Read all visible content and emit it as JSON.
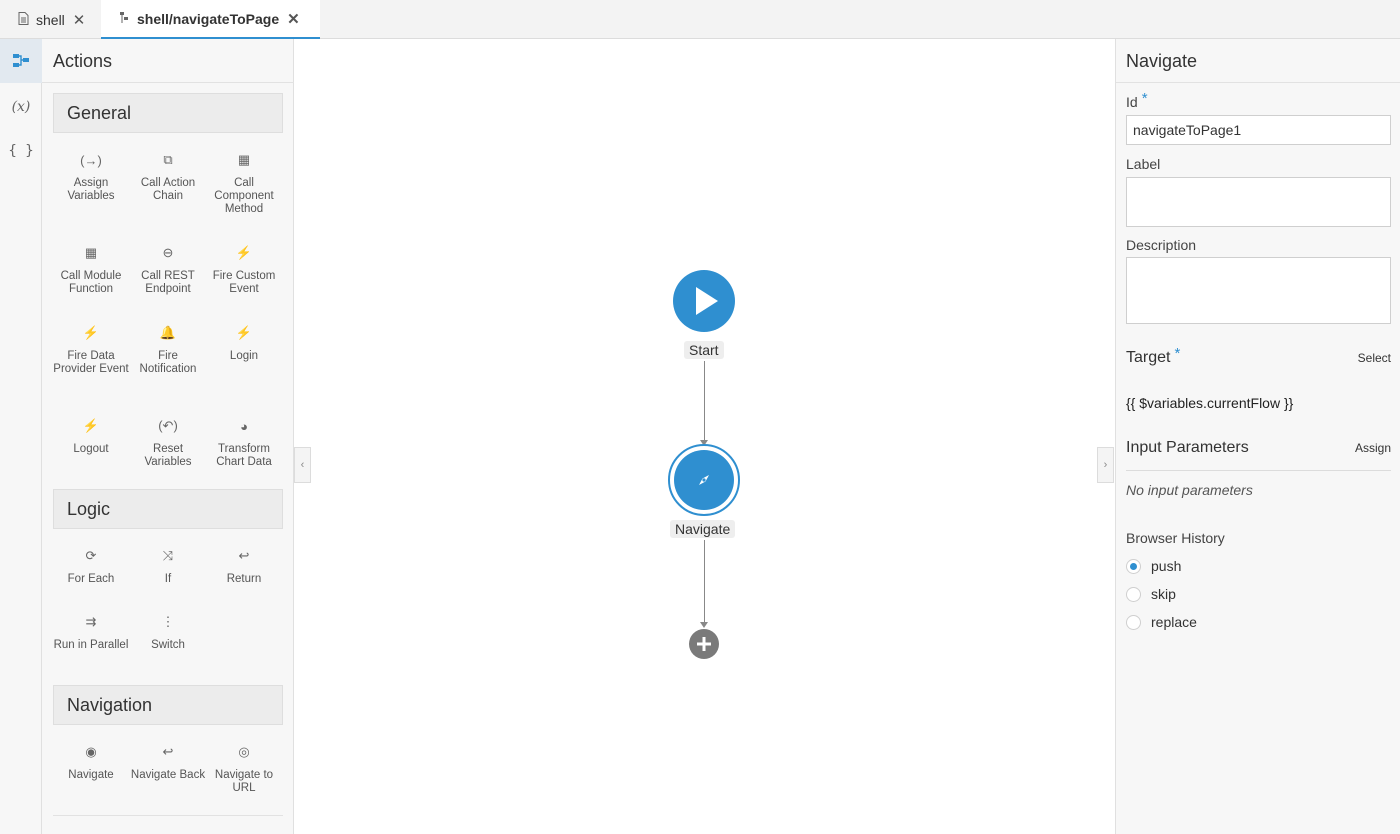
{
  "tabs": [
    {
      "label": "shell",
      "icon": "file-icon"
    },
    {
      "label": "shell/navigateToPage",
      "icon": "flow-icon"
    }
  ],
  "rail": {
    "items": [
      {
        "name": "actions-chain",
        "glyph": "⧉"
      },
      {
        "name": "variables",
        "glyph": "(x)"
      },
      {
        "name": "json",
        "glyph": "{ }"
      }
    ]
  },
  "palette": {
    "title": "Actions",
    "sections": [
      {
        "title": "General"
      },
      {
        "title": "Logic"
      },
      {
        "title": "Navigation"
      }
    ],
    "general": [
      {
        "label": "Assign Variables",
        "glyph": "(→)"
      },
      {
        "label": "Call Action Chain",
        "glyph": "⧉"
      },
      {
        "label": "Call Component Method",
        "glyph": "▦"
      },
      {
        "label": "Call Module Function",
        "glyph": "▦"
      },
      {
        "label": "Call REST Endpoint",
        "glyph": "⊖"
      },
      {
        "label": "Fire Custom Event",
        "glyph": "⚡"
      },
      {
        "label": "Fire Data Provider Event",
        "glyph": "⚡"
      },
      {
        "label": "Fire Notification",
        "glyph": "🔔"
      },
      {
        "label": "Login",
        "glyph": "⚡"
      },
      {
        "label": "Logout",
        "glyph": "⚡"
      },
      {
        "label": "Reset Variables",
        "glyph": "(↶)"
      },
      {
        "label": "Transform Chart Data",
        "glyph": "◕"
      }
    ],
    "logic": [
      {
        "label": "For Each",
        "glyph": "⟳"
      },
      {
        "label": "If",
        "glyph": "⤨"
      },
      {
        "label": "Return",
        "glyph": "↩"
      },
      {
        "label": "Run in Parallel",
        "glyph": "⇉"
      },
      {
        "label": "Switch",
        "glyph": "⋮"
      }
    ],
    "navigation": [
      {
        "label": "Navigate",
        "glyph": "◉"
      },
      {
        "label": "Navigate Back",
        "glyph": "↩"
      },
      {
        "label": "Navigate to URL",
        "glyph": "◎"
      }
    ]
  },
  "canvas": {
    "start_label": "Start",
    "navigate_label": "Navigate"
  },
  "props": {
    "title": "Navigate",
    "id_label": "Id",
    "id_value": "navigateToPage1",
    "label_label": "Label",
    "label_value": "",
    "description_label": "Description",
    "description_value": "",
    "target_label": "Target",
    "target_action": "Select",
    "target_value": "{{ $variables.currentFlow }}",
    "input_params_label": "Input Parameters",
    "input_params_action": "Assign",
    "input_params_empty": "No input parameters",
    "history_label": "Browser History",
    "history_options": [
      {
        "label": "push",
        "checked": true
      },
      {
        "label": "skip",
        "checked": false
      },
      {
        "label": "replace",
        "checked": false
      }
    ],
    "required_mark": "*"
  },
  "colors": {
    "accent": "#2f8fd0",
    "panel_bg": "#f7f7f7"
  }
}
